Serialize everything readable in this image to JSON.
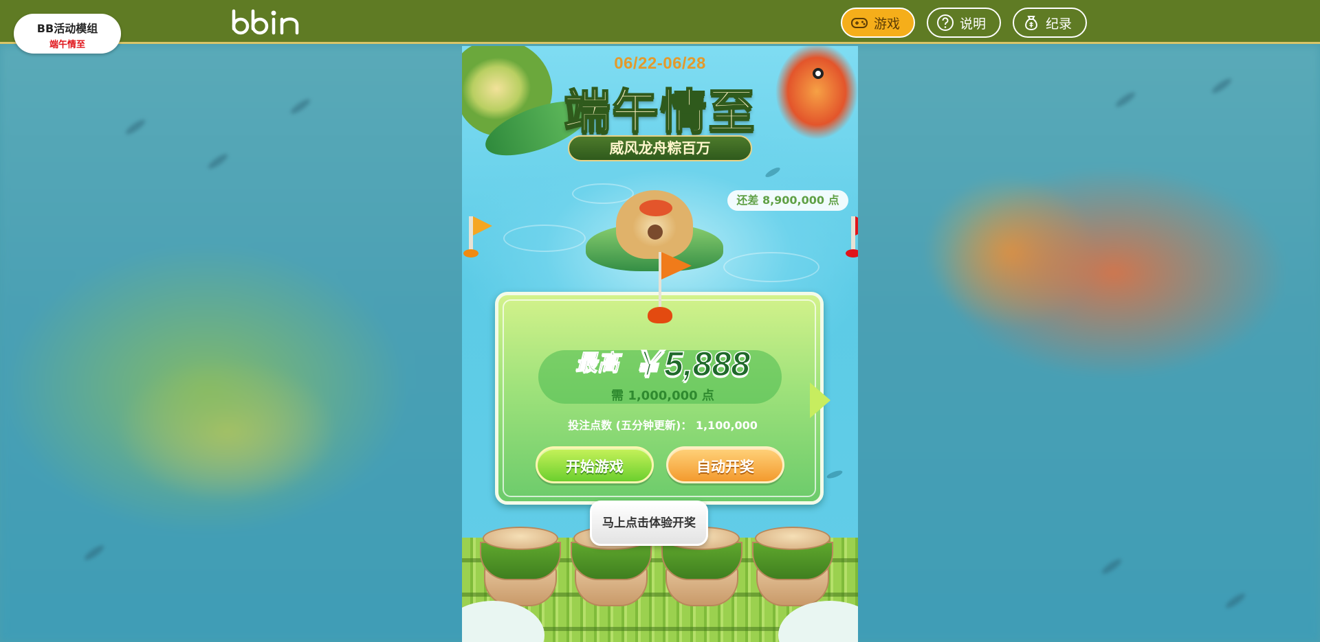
{
  "header": {
    "site_name": "BB活动模组",
    "site_subtitle": "端午情至",
    "logo_text": "bbin",
    "nav": {
      "game": "游戏",
      "help": "说明",
      "record": "纪录"
    }
  },
  "event": {
    "date_range": "06/22-06/28",
    "title": "端午情至",
    "subtitle": "威风龙舟粽百万",
    "remaining": "还差 8,900,000 点"
  },
  "prize": {
    "label": "最高",
    "value": "￥5,888",
    "need": "需 1,000,000 点",
    "bet_label": "投注点数 (五分钟更新)：",
    "bet_value": "1,100,000",
    "start_button": "开始游戏",
    "auto_button": "自动开奖"
  },
  "tooltip": "马上点击体验开奖",
  "colors": {
    "topbar": "#5f7b24",
    "accent_orange": "#f5ae1a",
    "card_green": "#9fe27b",
    "start_green": "#6ccf2e",
    "auto_orange": "#f39a2e"
  }
}
